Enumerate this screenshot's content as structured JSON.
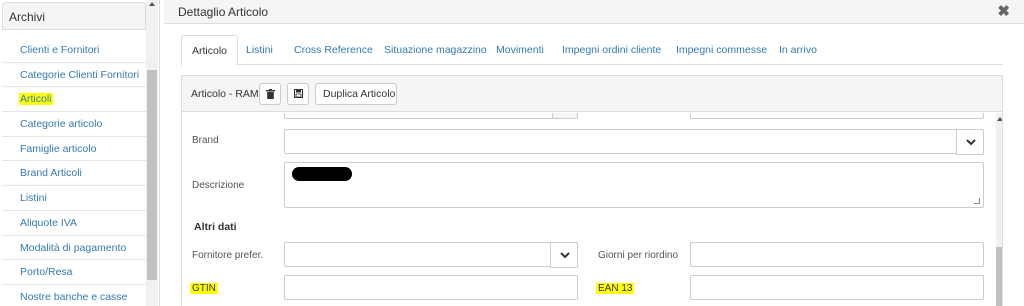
{
  "sidebar": {
    "title": "Archivi",
    "items": [
      {
        "label": "Clienti e Fornitori"
      },
      {
        "label": "Categorie Clienti Fornitori"
      },
      {
        "label": "Articoli"
      },
      {
        "label": "Categorie articolo"
      },
      {
        "label": "Famiglie articolo"
      },
      {
        "label": "Brand Articoli"
      },
      {
        "label": "Listini"
      },
      {
        "label": "Aliquote IVA"
      },
      {
        "label": "Modalità di pagamento"
      },
      {
        "label": "Porto/Resa"
      },
      {
        "label": "Nostre banche e casse"
      }
    ],
    "active_index": 2
  },
  "main": {
    "title": "Dettaglio Articolo",
    "close_glyph": "✖",
    "tabs": [
      {
        "label": "Articolo"
      },
      {
        "label": "Listini"
      },
      {
        "label": "Cross Reference"
      },
      {
        "label": "Situazione magazzino"
      },
      {
        "label": "Movimenti"
      },
      {
        "label": "Impegni ordini cliente"
      },
      {
        "label": "Impegni commesse"
      },
      {
        "label": "In arrivo"
      }
    ],
    "active_tab": 0
  },
  "panel": {
    "title": "Articolo - RAM",
    "duplicate_label": "Duplica Articolo",
    "icons": {
      "trash": "trash-icon",
      "save": "floppy-disk-icon",
      "chevron": "chevron-down-icon"
    }
  },
  "form": {
    "brand_label": "Brand",
    "brand_value": "",
    "description_label": "Descrizione",
    "section_label": "Altri dati",
    "supplier_label": "Fornitore prefer.",
    "supplier_value": "",
    "reorder_days_label": "Giorni per riordino",
    "reorder_days_value": "",
    "gtin_label": "GTIN",
    "gtin_value": "",
    "ean_label": "EAN 13",
    "ean_value": ""
  },
  "colors": {
    "highlight": "#ffff00",
    "link": "#337ab7",
    "header_bg": "#f5f5f5",
    "border": "#dddddd"
  }
}
